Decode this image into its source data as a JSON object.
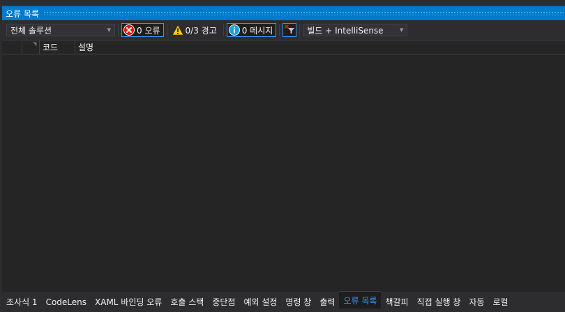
{
  "panel": {
    "title": "오류 목록"
  },
  "toolbar": {
    "scope": {
      "selected": "전체 솔루션"
    },
    "errors": {
      "label": "0 오류"
    },
    "warnings": {
      "label": "0/3 경고"
    },
    "messages": {
      "label": "0 메시지"
    },
    "source": {
      "selected": "빌드 + IntelliSense"
    }
  },
  "table": {
    "columns": [
      "코드",
      "설명"
    ]
  },
  "tabs": [
    "조사식 1",
    "CodeLens",
    "XAML 바인딩 오류",
    "호출 스택",
    "중단점",
    "예외 설정",
    "명령 창",
    "출력",
    "오류 목록",
    "책갈피",
    "직접 실행 창",
    "자동",
    "로컬"
  ],
  "active_tab": "오류 목록",
  "colors": {
    "accent": "#007acc",
    "error": "#e51400",
    "warning": "#ffcc00",
    "info": "#1ba1e2"
  }
}
